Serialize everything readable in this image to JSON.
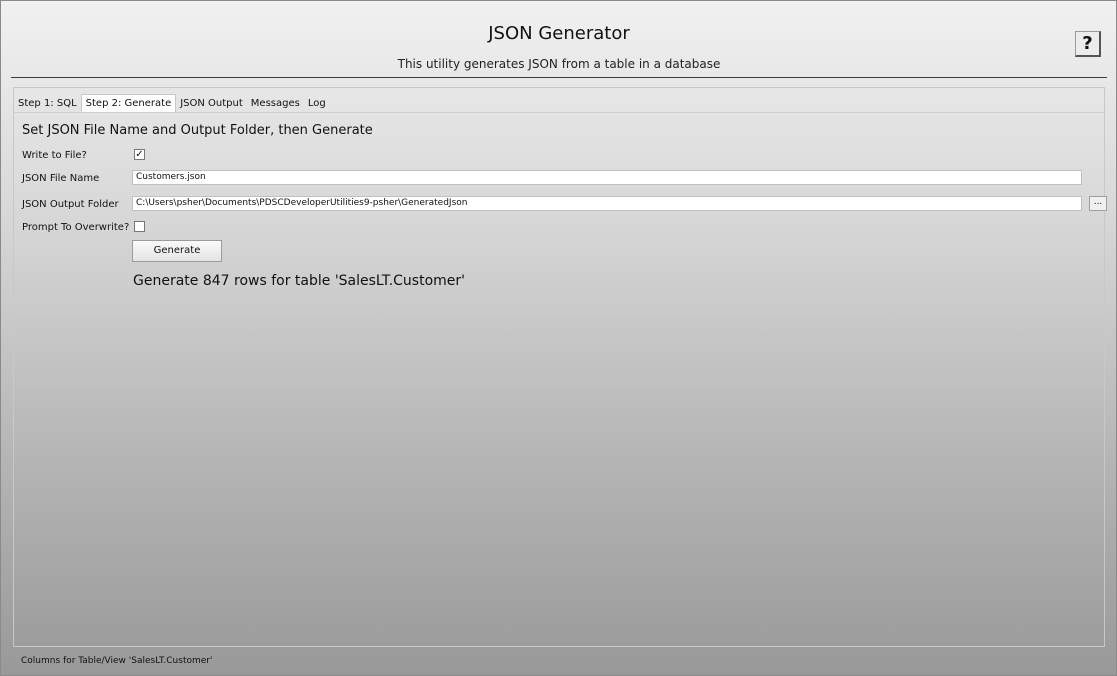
{
  "header": {
    "title": "JSON Generator",
    "subtitle": "This utility generates JSON from a table in a database",
    "help_label": "?"
  },
  "tabs": [
    {
      "label": "Step 1: SQL",
      "active": false
    },
    {
      "label": "Step 2: Generate",
      "active": true
    },
    {
      "label": "JSON Output",
      "active": false
    },
    {
      "label": "Messages",
      "active": false
    },
    {
      "label": "Log",
      "active": false
    }
  ],
  "form": {
    "section_title": "Set JSON File Name and Output Folder, then Generate",
    "write_to_file_label": "Write to File?",
    "write_to_file_checked": true,
    "file_name_label": "JSON File Name",
    "file_name_value": "Customers.json",
    "output_folder_label": "JSON Output Folder",
    "output_folder_value": "C:\\Users\\psher\\Documents\\PDSCDeveloperUtilities9-psher\\GeneratedJson",
    "browse_label": "...",
    "prompt_overwrite_label": "Prompt To Overwrite?",
    "prompt_overwrite_checked": false,
    "generate_label": "Generate",
    "result_message": "Generate 847 rows for table 'SalesLT.Customer'"
  },
  "status": {
    "text": "Columns for Table/View 'SalesLT.Customer'"
  },
  "icons": {
    "checkmark": "checkmark-icon"
  },
  "colors": {
    "window_gradient_top": "#f1f1f1",
    "window_gradient_bottom": "#999999",
    "header_rule": "#3b3b3b"
  }
}
